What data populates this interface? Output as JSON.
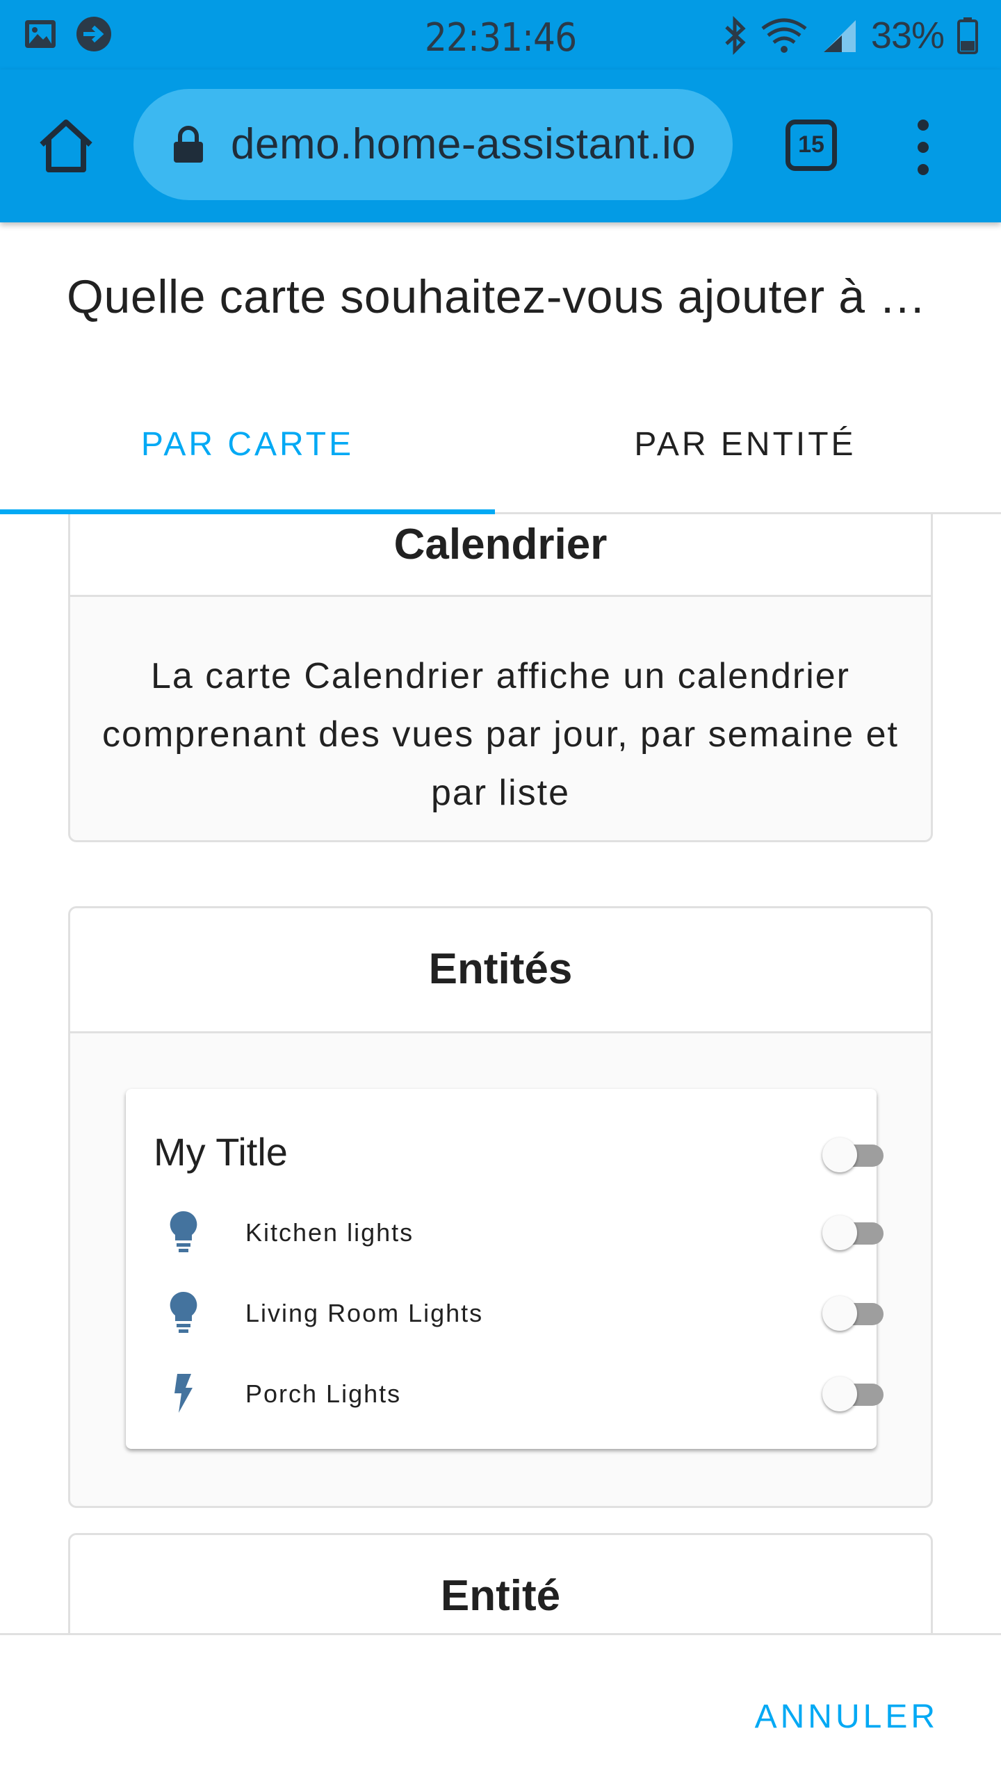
{
  "status_bar": {
    "time": "22:31:46",
    "battery_percent": "33%",
    "icons": [
      "image-icon",
      "cast-arrow-icon",
      "bluetooth-icon",
      "wifi-icon",
      "cell-signal-icon",
      "battery-icon"
    ]
  },
  "browser": {
    "url": "demo.home-assistant.io",
    "tab_count": "15",
    "accent": "#039be5"
  },
  "dialog": {
    "title": "Quelle carte souhaitez-vous ajouter à …",
    "tabs": [
      {
        "label": "PAR CARTE",
        "active": true
      },
      {
        "label": "PAR ENTITÉ",
        "active": false
      }
    ],
    "cancel_label": "ANNULER",
    "accent": "#03a9f4"
  },
  "cards": [
    {
      "title": "Calendrier",
      "description": "La carte Calendrier affiche un calendrier comprenant des vues par jour, par semaine et par liste"
    },
    {
      "title": "Entités",
      "preview": {
        "title": "My Title",
        "rows": [
          {
            "name": "Kitchen lights",
            "icon": "lightbulb-icon",
            "on": false
          },
          {
            "name": "Living Room Lights",
            "icon": "lightbulb-icon",
            "on": false
          },
          {
            "name": "Porch Lights",
            "icon": "flash-icon",
            "on": false
          }
        ]
      }
    },
    {
      "title": "Entité"
    }
  ]
}
